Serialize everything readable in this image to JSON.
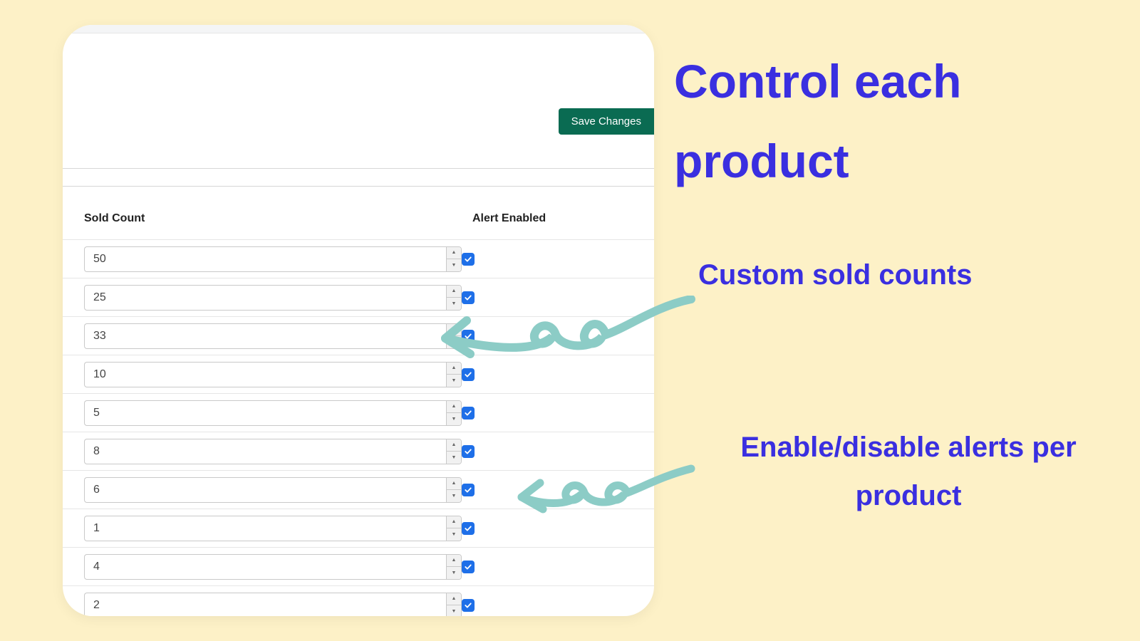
{
  "toolbar": {
    "save_label": "Save Changes"
  },
  "headers": {
    "sold_count": "Sold Count",
    "alert_enabled": "Alert Enabled"
  },
  "rows": [
    {
      "sold": "50",
      "alert": true
    },
    {
      "sold": "25",
      "alert": true
    },
    {
      "sold": "33",
      "alert": true
    },
    {
      "sold": "10",
      "alert": true
    },
    {
      "sold": "5",
      "alert": true
    },
    {
      "sold": "8",
      "alert": true
    },
    {
      "sold": "6",
      "alert": true
    },
    {
      "sold": "1",
      "alert": true
    },
    {
      "sold": "4",
      "alert": true
    },
    {
      "sold": "2",
      "alert": true
    }
  ],
  "promo": {
    "heading": "Control each product",
    "sub1": "Custom sold counts",
    "sub2": "Enable/disable alerts per product"
  },
  "colors": {
    "accent": "#3a2fe0",
    "save_bg": "#0a6b52",
    "checkbox": "#1e6fe8",
    "arrow": "#8cccc6"
  }
}
